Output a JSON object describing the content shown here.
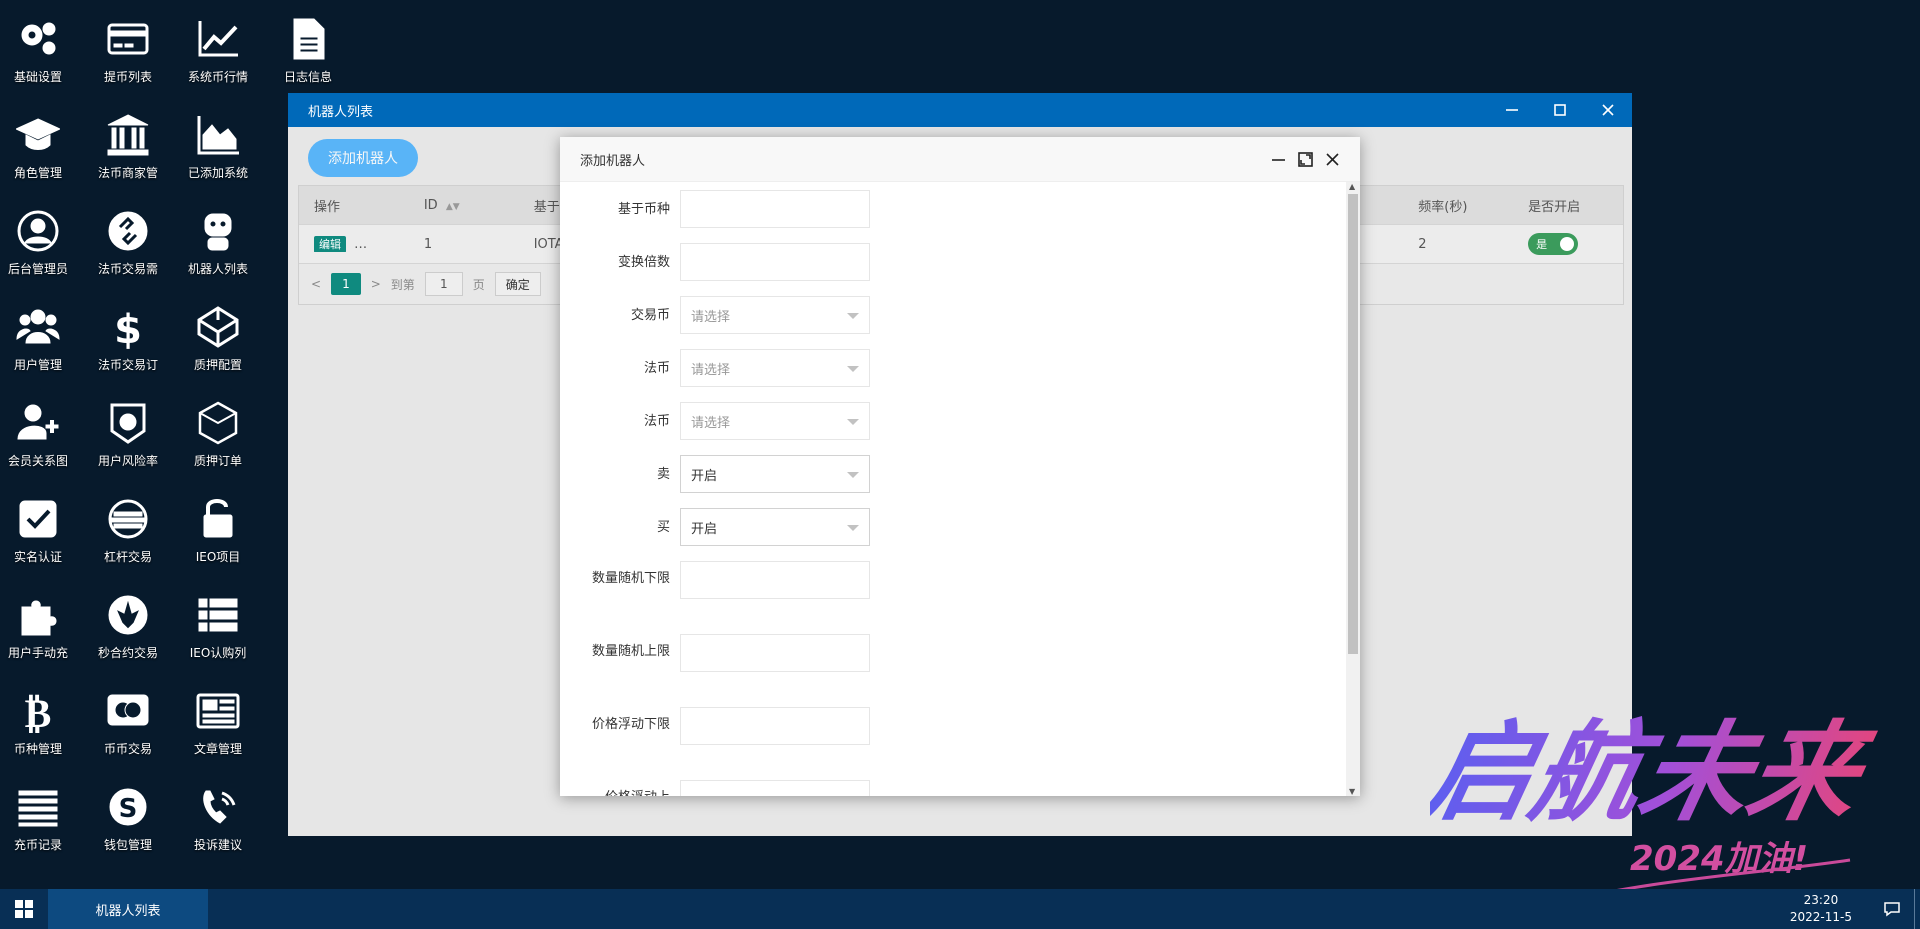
{
  "desktop_icons": [
    {
      "label": "基础设置",
      "icon": "gears-icon"
    },
    {
      "label": "提币列表",
      "icon": "credit-card-icon"
    },
    {
      "label": "系统币行情",
      "icon": "line-chart-icon"
    },
    {
      "label": "日志信息",
      "icon": "document-icon"
    },
    {
      "label": "角色管理",
      "icon": "graduation-cap-icon"
    },
    {
      "label": "法币商家管",
      "icon": "bank-icon"
    },
    {
      "label": "已添加系统",
      "icon": "area-chart-icon"
    },
    {
      "label": "后台管理员",
      "icon": "user-circle-icon"
    },
    {
      "label": "法币交易需",
      "icon": "exchange-circle-icon"
    },
    {
      "label": "机器人列表",
      "icon": "robot-icon"
    },
    {
      "label": "用户管理",
      "icon": "users-icon"
    },
    {
      "label": "法币交易订",
      "icon": "dollar-icon"
    },
    {
      "label": "质押配置",
      "icon": "codepen-icon"
    },
    {
      "label": "会员关系图",
      "icon": "user-plus-icon"
    },
    {
      "label": "用户风险率",
      "icon": "shield-coin-icon"
    },
    {
      "label": "质押订单",
      "icon": "polyhedron-icon"
    },
    {
      "label": "实名认证",
      "icon": "checkbox-icon"
    },
    {
      "label": "杠杆交易",
      "icon": "stacked-coin-icon"
    },
    {
      "label": "IEO项目",
      "icon": "unlock-icon"
    },
    {
      "label": "用户手动充",
      "icon": "puzzle-icon"
    },
    {
      "label": "秒合约交易",
      "icon": "rebel-icon"
    },
    {
      "label": "IEO认购列",
      "icon": "list-icon"
    },
    {
      "label": "币种管理",
      "icon": "bitcoin-icon"
    },
    {
      "label": "币币交易",
      "icon": "mastercard-icon"
    },
    {
      "label": "文章管理",
      "icon": "newspaper-icon"
    },
    {
      "label": "充币记录",
      "icon": "lines-icon"
    },
    {
      "label": "钱包管理",
      "icon": "skype-icon"
    },
    {
      "label": "投诉建议",
      "icon": "phone-volume-icon"
    }
  ],
  "window": {
    "title": "机器人列表",
    "add_button": "添加机器人",
    "table": {
      "headers": [
        "操作",
        "ID",
        "基于",
        "频率(秒)",
        "是否开启"
      ],
      "row": {
        "action": "编辑",
        "action_more": "…",
        "id": "1",
        "base": "IOTA",
        "frequency": "2",
        "enabled": "是"
      }
    },
    "pager": {
      "current": "1",
      "goto_label": "到第",
      "goto_value": "1",
      "page_label": "页",
      "confirm": "确定"
    }
  },
  "modal": {
    "title": "添加机器人",
    "fields": [
      {
        "label": "基于币种",
        "value": "",
        "type": "input"
      },
      {
        "label": "变换倍数",
        "value": "",
        "type": "input"
      },
      {
        "label": "交易币",
        "value": "请选择",
        "type": "select-placeholder"
      },
      {
        "label": "法币",
        "value": "请选择",
        "type": "select-placeholder"
      },
      {
        "label": "法币",
        "value": "请选择",
        "type": "select-placeholder"
      },
      {
        "label": "卖",
        "value": "开启",
        "type": "select"
      },
      {
        "label": "买",
        "value": "开启",
        "type": "select"
      },
      {
        "label": "数量随机下限",
        "value": "",
        "type": "input"
      },
      {
        "label": "数量随机上限",
        "value": "",
        "type": "input"
      },
      {
        "label": "价格浮动下限",
        "value": "",
        "type": "input"
      },
      {
        "label": "价格浮动上",
        "value": "",
        "type": "input"
      }
    ]
  },
  "watermark": {
    "main": "启航未来",
    "sub": "2024加油!"
  },
  "taskbar": {
    "task": "机器人列表",
    "time": "23:20",
    "date": "2022-11-5"
  },
  "colors": {
    "desktop_bg": "#071a2c",
    "titlebar": "#0069b9",
    "primary_button": "#1e9fff",
    "teal": "#0f8a7f",
    "taskbar": "#082f55"
  }
}
